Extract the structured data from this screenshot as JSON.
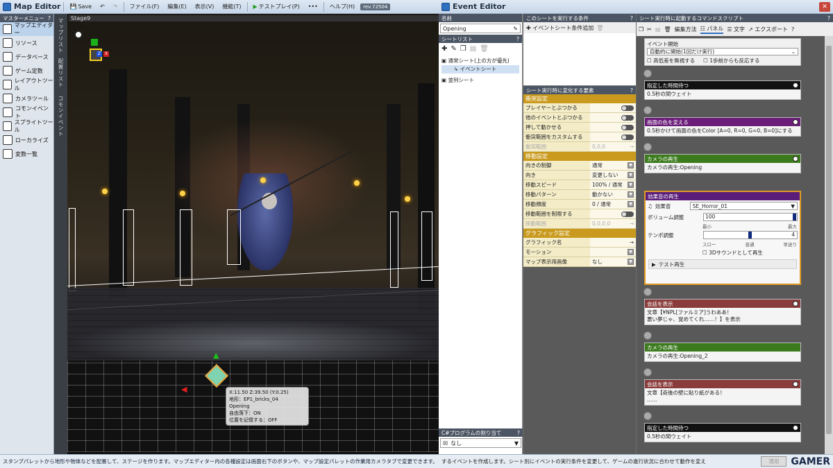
{
  "map_editor": {
    "title": "Map Editor",
    "toolbar": {
      "save": "Save",
      "file": "ファイル(F)",
      "edit": "編集(E)",
      "view": "表示(V)",
      "function": "機能(T)",
      "testplay": "テストプレイ(P)",
      "more": "•••",
      "help": "ヘルプ(H)",
      "rev": "rev.72504"
    },
    "master_menu": {
      "title": "マスターメニュー",
      "items": [
        {
          "label": "マップエディター",
          "icon": "map-icon"
        },
        {
          "label": "リソース",
          "icon": "resource-icon"
        },
        {
          "label": "データベース",
          "icon": "database-icon"
        },
        {
          "label": "ゲーム定数",
          "icon": "game-constant-icon"
        },
        {
          "label": "レイアウトツール",
          "icon": "layout-icon"
        },
        {
          "label": "カメラツール",
          "icon": "camera-icon"
        },
        {
          "label": "コモンイベント",
          "icon": "common-event-icon"
        },
        {
          "label": "スプライトツール",
          "icon": "sprite-icon"
        },
        {
          "label": "ローカライズ",
          "icon": "localize-icon"
        },
        {
          "label": "変数一覧",
          "icon": "variables-icon"
        }
      ]
    },
    "vertical_tabs": [
      "マップリスト",
      "配置リスト",
      "コモンイベント"
    ],
    "viewport": {
      "stage_label": "Stage9",
      "info": {
        "coords": "X:11.50 Z:39.50 (Y:0.25)",
        "terrain": "地形：EP1_bricks_04",
        "event": "Opening",
        "freefall": "自由落下：ON",
        "position_record": "位置を記憶する：OFF"
      }
    },
    "status": "スタンプパレットから地形や物体などを配置して、ステージを作ります。マップエディター内の各種設定は画面右下のボタンや、マップ設定パレットの作業用カメラタブで変更できます。"
  },
  "event_editor": {
    "title": "Event Editor",
    "name": {
      "label": "名前",
      "value": "Opening"
    },
    "sheet_list": {
      "title": "シートリスト",
      "items": [
        "通常シート(上の方が優先)",
        "イベントシート",
        "並列シート"
      ]
    },
    "csharp": {
      "title": "C#プログラムの割り当て",
      "value": "なし"
    },
    "conditions": {
      "title": "このシートを実行する条件",
      "add_button": "イベントシート条件追加"
    },
    "properties": {
      "title": "シート実行時に変化する要素",
      "sections": [
        {
          "name": "衝突設定",
          "rows": [
            {
              "key": "プレイヤーとぶつかる",
              "value": "",
              "control": "toggle"
            },
            {
              "key": "他のイベントとぶつかる",
              "value": "",
              "control": "toggle"
            },
            {
              "key": "押して動かせる",
              "value": "",
              "control": "toggle"
            },
            {
              "key": "衝突範囲をカスタムする",
              "value": "",
              "control": "toggle"
            },
            {
              "key": "衝突範囲",
              "value": "0,0,0",
              "control": "arrow",
              "disabled": true
            }
          ]
        },
        {
          "name": "移動設定",
          "rows": [
            {
              "key": "向きの制御",
              "value": "通常",
              "control": "dropdown"
            },
            {
              "key": "向き",
              "value": "変更しない",
              "control": "dropdown"
            },
            {
              "key": "移動スピード",
              "value": "100% / 通常",
              "control": "dropdown"
            },
            {
              "key": "移動パターン",
              "value": "動かない",
              "control": "dropdown"
            },
            {
              "key": "移動頻度",
              "value": "0 / 通常",
              "control": "dropdown"
            },
            {
              "key": "移動範囲を制限する",
              "value": "",
              "control": "toggle"
            },
            {
              "key": "移動範囲",
              "value": "0,0,0,0",
              "control": "arrow",
              "disabled": true
            }
          ]
        },
        {
          "name": "グラフィック設定",
          "rows": [
            {
              "key": "グラフィック名",
              "value": "",
              "control": "arrow"
            },
            {
              "key": "モーション",
              "value": "",
              "control": "dropdown"
            },
            {
              "key": "マップ表示用画像",
              "value": "なし",
              "control": "dropdown"
            }
          ]
        }
      ]
    },
    "script": {
      "title": "シート実行時に起動するコマンドスクリプト",
      "toolbar": {
        "edit_method": "編集方法",
        "panel": "パネル",
        "text": "文字",
        "export": "エクスポート"
      },
      "start_block": {
        "title": "イベント開始",
        "trigger": "自動的に開始(1回だけ実行)",
        "opt1": "高低差を無視する",
        "opt2": "1歩前からも反応する"
      },
      "commands": [
        {
          "title": "指定した時間待つ",
          "body": "0.5秒の間ウェイト",
          "color": "#111111",
          "clock": true
        },
        {
          "title": "画面の色を変える",
          "body": "0.5秒かけて画面の色をColor [A=0, R=0, G=0, B=0]にする",
          "color": "#6b1d7a",
          "clock": true
        },
        {
          "title": "カメラの再生",
          "body": "カメラの再生:Opening",
          "color": "#3c7a1e",
          "clock": true
        }
      ],
      "sound_block": {
        "title": "効果音の再生",
        "se_label": "効果音",
        "se_value": "SE_Horror_01",
        "volume_label": "ボリューム調整",
        "volume_value": "100",
        "volume_min": "最小",
        "volume_max": "最大",
        "volume_level": 1.0,
        "tempo_label": "テンポ調整",
        "tempo_value": "4",
        "tempo_slow": "スロー",
        "tempo_normal": "普通",
        "tempo_fast": "早送り",
        "tempo_level": 0.5,
        "surround": "3Dサウンドとして再生",
        "test": "テスト再生"
      },
      "commands2": [
        {
          "title": "会話を表示",
          "body": "文章【¥NPL[ファルミア]うわああ！\n悪い夢じゃ、覚めてくれ……！】を表示",
          "color": "#8a3b3b",
          "clock": true
        },
        {
          "title": "カメラの再生",
          "body": "カメラの再生:Opening_2",
          "color": "#3c7a1e",
          "clock": false
        },
        {
          "title": "会話を表示",
          "body": "文章【奇後の壁に貼り紙がある！\n……",
          "color": "#8a3b3b",
          "clock": true
        },
        {
          "title": "指定した時間待つ",
          "body": "0.5秒の間ウェイト",
          "color": "#111111",
          "clock": true
        }
      ]
    },
    "status": "するイベントを作成します。シート別にイベントの実行条件を変更して、ゲームの進行状況に合わせて動作を変え",
    "apply_button": "適用",
    "watermark": "GAMER"
  },
  "colors": {
    "accent_gold": "#c99a1e",
    "selection_blue": "#bcd3ec",
    "orange_border": "#e39b25"
  }
}
